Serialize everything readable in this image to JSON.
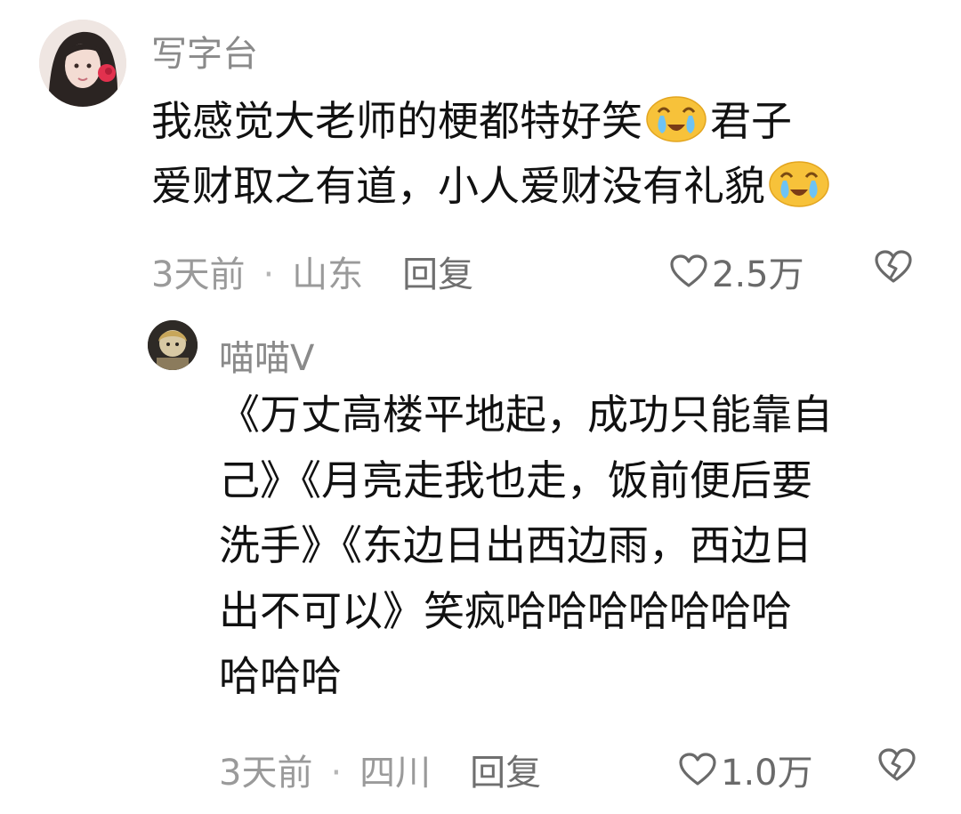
{
  "comments": [
    {
      "username": "写字台",
      "text_line1_a": "我感觉大老师的梗都特好笑",
      "text_line1_b": "君子",
      "text_line2": "爱财取之有道，小人爱财没有礼貌",
      "emoji": "laugh-cry-emoji",
      "time": "3天前",
      "separator": "·",
      "location": "山东",
      "reply_label": "回复",
      "likes": "2.5万"
    },
    {
      "username": "喵喵V",
      "text_lines": [
        "《万丈高楼平地起，成功只能靠自",
        "己》《月亮走我也走，饭前便后要",
        "洗手》《东边日出西边雨，西边日",
        "出不可以》笑疯哈哈哈哈哈哈哈",
        "哈哈哈"
      ],
      "time": "3天前",
      "separator": "·",
      "location": "四川",
      "reply_label": "回复",
      "likes": "1.0万"
    }
  ],
  "icons": {
    "like": "heart-outline-icon",
    "dislike": "broken-heart-icon"
  },
  "colors": {
    "meta_text": "#9a9a9a",
    "username": "#8a8a8a",
    "body_text": "#111111",
    "emoji_face": "#f7c23a"
  }
}
